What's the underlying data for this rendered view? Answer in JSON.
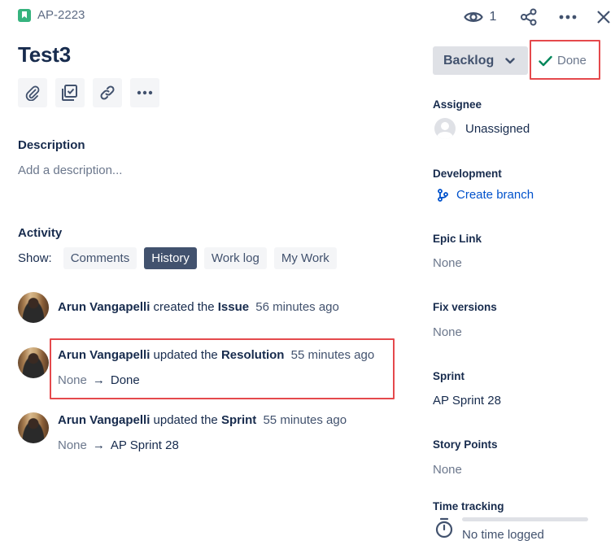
{
  "header": {
    "issue_key": "AP-2223",
    "watch_count": "1"
  },
  "issue": {
    "title": "Test3"
  },
  "description": {
    "label": "Description",
    "placeholder": "Add a description..."
  },
  "activity": {
    "label": "Activity",
    "show_label": "Show:",
    "filters": [
      {
        "label": "Comments",
        "active": false
      },
      {
        "label": "History",
        "active": true
      },
      {
        "label": "Work log",
        "active": false
      },
      {
        "label": "My Work",
        "active": false
      }
    ],
    "history": [
      {
        "user": "Arun Vangapelli",
        "action": "created the",
        "field": "Issue",
        "time": "56 minutes ago"
      },
      {
        "user": "Arun Vangapelli",
        "action": "updated the",
        "field": "Resolution",
        "time": "55 minutes ago",
        "old": "None",
        "arrow": "→",
        "new": "Done"
      },
      {
        "user": "Arun Vangapelli",
        "action": "updated the",
        "field": "Sprint",
        "time": "55 minutes ago",
        "old": "None",
        "arrow": "→",
        "new": "AP Sprint 28"
      }
    ]
  },
  "status": {
    "current": "Backlog",
    "transition": "Done"
  },
  "fields": {
    "assignee": {
      "label": "Assignee",
      "value": "Unassigned"
    },
    "development": {
      "label": "Development",
      "action": "Create branch"
    },
    "epic_link": {
      "label": "Epic Link",
      "value": "None"
    },
    "fix_versions": {
      "label": "Fix versions",
      "value": "None"
    },
    "sprint": {
      "label": "Sprint",
      "value": "AP Sprint 28"
    },
    "story_points": {
      "label": "Story Points",
      "value": "None"
    },
    "time_tracking": {
      "label": "Time tracking",
      "value": "No time logged",
      "progress": 0
    }
  },
  "colors": {
    "accent": "#0052cc",
    "highlight": "#e5494c",
    "done_check": "#00875a",
    "story_icon": "#36b37e"
  },
  "icons": [
    "story-icon",
    "eye-icon",
    "share-icon",
    "more-icon",
    "close-icon",
    "paperclip-icon",
    "child-issue-icon",
    "link-icon",
    "chevron-down-icon",
    "check-icon",
    "branch-icon",
    "stopwatch-icon"
  ]
}
